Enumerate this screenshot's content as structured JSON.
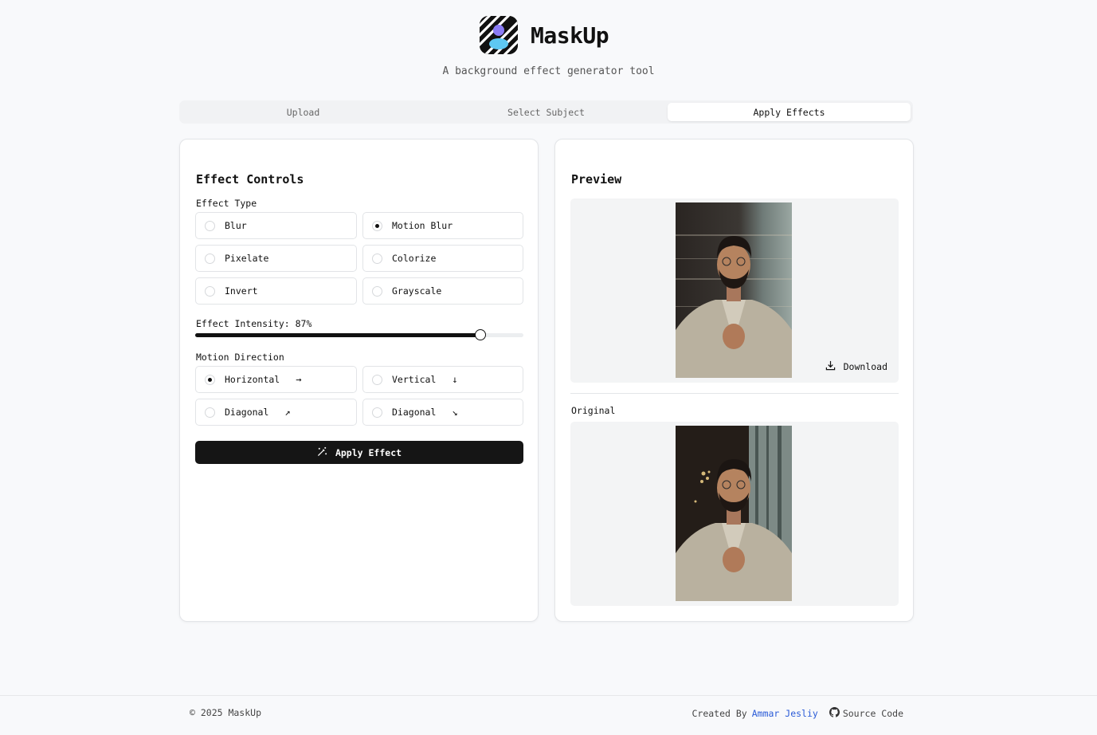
{
  "app": {
    "title": "MaskUp",
    "subtitle": "A background effect generator tool"
  },
  "tabs": [
    {
      "label": "Upload",
      "active": false
    },
    {
      "label": "Select Subject",
      "active": false
    },
    {
      "label": "Apply Effects",
      "active": true
    }
  ],
  "controls": {
    "title": "Effect Controls",
    "effect_type_label": "Effect Type",
    "effect_types": [
      {
        "label": "Blur",
        "checked": false
      },
      {
        "label": "Motion Blur",
        "checked": true
      },
      {
        "label": "Pixelate",
        "checked": false
      },
      {
        "label": "Colorize",
        "checked": false
      },
      {
        "label": "Invert",
        "checked": false
      },
      {
        "label": "Grayscale",
        "checked": false
      }
    ],
    "intensity_label": "Effect Intensity: 87%",
    "intensity_value": 87,
    "direction_label": "Motion Direction",
    "directions": [
      {
        "label": "Horizontal",
        "icon": "arrow-right-icon",
        "glyph": "→",
        "checked": true
      },
      {
        "label": "Vertical",
        "icon": "arrow-down-icon",
        "glyph": "↓",
        "checked": false
      },
      {
        "label": "Diagonal",
        "icon": "arrow-up-right-icon",
        "glyph": "↗",
        "checked": false
      },
      {
        "label": "Diagonal",
        "icon": "arrow-down-right-icon",
        "glyph": "↘",
        "checked": false
      }
    ],
    "apply_label": "Apply Effect"
  },
  "preview": {
    "title": "Preview",
    "download_label": "Download",
    "original_label": "Original"
  },
  "footer": {
    "copyright": "© 2025 MaskUp",
    "created_by": "Created By",
    "author": "Ammar Jesliy",
    "source": "Source Code"
  },
  "colors": {
    "accent": "#151515",
    "link": "#2a5bd7",
    "background": "#f8f9fb"
  }
}
